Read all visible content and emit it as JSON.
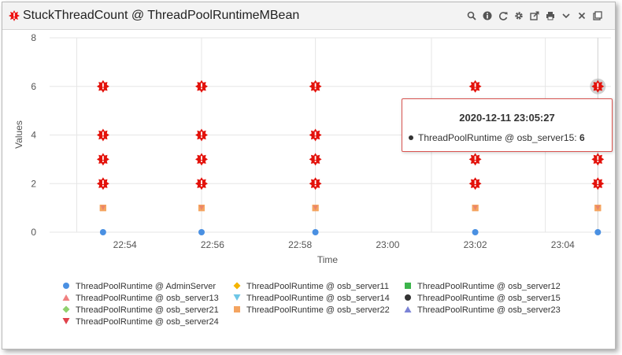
{
  "window": {
    "title": "StuckThreadCount @ ThreadPoolRuntimeMBean"
  },
  "toolbar": [
    {
      "name": "search-icon",
      "glyph": "search"
    },
    {
      "name": "info-icon",
      "glyph": "info"
    },
    {
      "name": "refresh-icon",
      "glyph": "refresh"
    },
    {
      "name": "gear-icon",
      "glyph": "gear"
    },
    {
      "name": "export-icon",
      "glyph": "export"
    },
    {
      "name": "print-icon",
      "glyph": "print"
    },
    {
      "name": "chevron-down-icon",
      "glyph": "chevron"
    },
    {
      "name": "close-icon",
      "glyph": "close"
    },
    {
      "name": "popout-icon",
      "glyph": "popout"
    }
  ],
  "tooltip": {
    "title": "2020-12-11 23:05:27",
    "series": "ThreadPoolRuntime @ osb_server15:",
    "value": "6"
  },
  "chart_data": {
    "type": "scatter",
    "title": "",
    "xlabel": "Time",
    "ylabel": "Values",
    "ylim": [
      0,
      8
    ],
    "y_ticks": [
      "0",
      "2",
      "4",
      "6",
      "8"
    ],
    "x_ticks": [
      "22:54",
      "22:56",
      "22:58",
      "23:00",
      "23:02",
      "23:04"
    ],
    "x_tick_minutes": [
      0,
      2,
      4,
      6,
      8,
      10
    ],
    "x_range_minutes": [
      -1.9,
      11.1
    ],
    "sample_minutes": [
      -0.5,
      1.75,
      4.35,
      8.0,
      10.8
    ],
    "highlight": {
      "series": "ThreadPoolRuntime @ osb_server15",
      "point_index": 4
    },
    "grid": true,
    "legend_position": "bottom",
    "series": [
      {
        "name": "ThreadPoolRuntime @ AdminServer",
        "symbol": "circle",
        "color": "#4a90e2",
        "values": [
          0,
          0,
          0,
          0,
          0
        ]
      },
      {
        "name": "ThreadPoolRuntime @ osb_server11",
        "symbol": "diamond",
        "color": "#f5b400",
        "values": [
          1,
          1,
          1,
          1,
          1
        ]
      },
      {
        "name": "ThreadPoolRuntime @ osb_server12",
        "symbol": "square",
        "color": "#3cb44b",
        "values": [
          1,
          1,
          1,
          1,
          1
        ]
      },
      {
        "name": "ThreadPoolRuntime @ osb_server13",
        "symbol": "triangle-up",
        "color": "#f08080",
        "values": [
          1,
          1,
          1,
          1,
          1
        ]
      },
      {
        "name": "ThreadPoolRuntime @ osb_server14",
        "symbol": "triangle-down",
        "color": "#6ec6e6",
        "values": [
          1,
          1,
          1,
          1,
          1
        ]
      },
      {
        "name": "ThreadPoolRuntime @ osb_server15",
        "symbol": "circle",
        "color": "#333333",
        "alert": true,
        "values": [
          6,
          6,
          6,
          6,
          6
        ]
      },
      {
        "name": "ThreadPoolRuntime @ osb_server21",
        "symbol": "diamond",
        "color": "#8fd16e",
        "alert": true,
        "values": [
          2,
          2,
          2,
          2,
          2
        ]
      },
      {
        "name": "ThreadPoolRuntime @ osb_server22",
        "symbol": "square",
        "color": "#f4a460",
        "values": [
          1,
          1,
          1,
          1,
          1
        ]
      },
      {
        "name": "ThreadPoolRuntime @ osb_server23",
        "symbol": "triangle-up",
        "color": "#7b83d6",
        "alert": true,
        "values": [
          3,
          3,
          3,
          3,
          3
        ]
      },
      {
        "name": "ThreadPoolRuntime @ osb_server24",
        "symbol": "triangle-down",
        "color": "#e0424b",
        "alert": true,
        "values": [
          4,
          4,
          4,
          4,
          4
        ]
      }
    ]
  }
}
